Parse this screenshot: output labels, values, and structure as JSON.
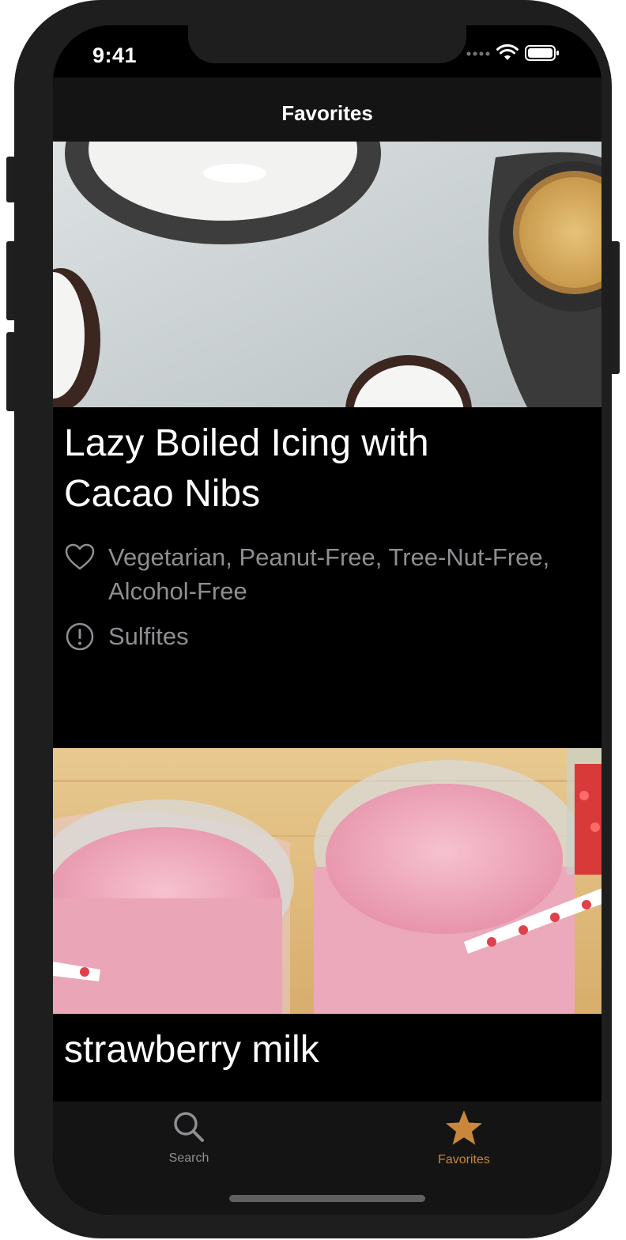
{
  "status_bar": {
    "time": "9:41"
  },
  "nav": {
    "title": "Favorites"
  },
  "recipes": [
    {
      "title": "Lazy Boiled Icing with Cacao Nibs",
      "health_labels": "Vegetarian, Peanut-Free, Tree-Nut-Free, Alcohol-Free",
      "cautions": "Sulfites",
      "image_icon": "icing-photo"
    },
    {
      "title": "strawberry milk",
      "image_icon": "strawberry-milk-photo"
    }
  ],
  "tabs": [
    {
      "label": "Search",
      "icon": "search-icon",
      "active": false
    },
    {
      "label": "Favorites",
      "icon": "star-icon",
      "active": true
    }
  ],
  "colors": {
    "accent": "#c8873a",
    "inactive_tab": "#8e8e93",
    "background": "#000000",
    "bar": "#141414",
    "meta_text": "#8e8e93"
  }
}
